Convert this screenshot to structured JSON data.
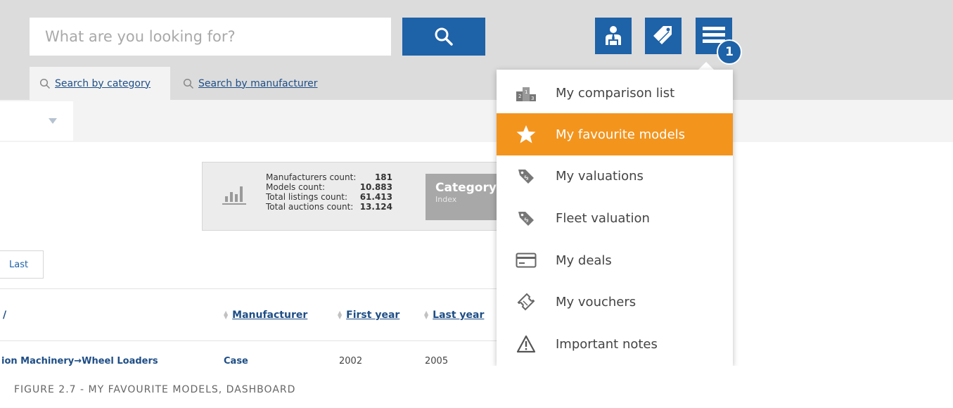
{
  "search": {
    "placeholder": "What are you looking for?"
  },
  "tabs": [
    {
      "label": "Search by category",
      "active": true
    },
    {
      "label": "Search by manufacturer",
      "active": false
    }
  ],
  "header_icons": [
    "dealer-user-icon",
    "price-tags-icon",
    "hamburger-menu-icon"
  ],
  "badge": "1",
  "stats": {
    "rows": [
      {
        "label": "Manufacturers count:",
        "value": "181"
      },
      {
        "label": "Models count:",
        "value": "10.883"
      },
      {
        "label": "Total listings count:",
        "value": "61.413"
      },
      {
        "label": "Total auctions count:",
        "value": "13.124"
      }
    ],
    "category_title": "Category",
    "category_sub": "Index"
  },
  "pager": {
    "last_label": "Last"
  },
  "table": {
    "first_col_fragment": "/",
    "headers": [
      "Manufacturer",
      "First year",
      "Last year"
    ],
    "row": {
      "category": "ion Machinery→Wheel Loaders",
      "manufacturer": "Case",
      "first_year": "2002",
      "last_year": "2005"
    }
  },
  "menu": {
    "items": [
      {
        "label": "My comparison list",
        "icon": "podium-icon",
        "active": false
      },
      {
        "label": "My favourite models",
        "icon": "star-icon",
        "active": true
      },
      {
        "label": "My valuations",
        "icon": "price-tag-icon",
        "active": false
      },
      {
        "label": "Fleet valuation",
        "icon": "price-tag-icon",
        "active": false
      },
      {
        "label": "My deals",
        "icon": "credit-card-icon",
        "active": false
      },
      {
        "label": "My vouchers",
        "icon": "ticket-icon",
        "active": false
      },
      {
        "label": "Important notes",
        "icon": "warning-icon",
        "active": false
      }
    ]
  },
  "caption": "FIGURE 2.7 - MY FAVOURITE MODELS, DASHBOARD",
  "colors": {
    "primary": "#1e62a8",
    "accent": "#f3941d",
    "header_bg": "#dcdcdc"
  }
}
